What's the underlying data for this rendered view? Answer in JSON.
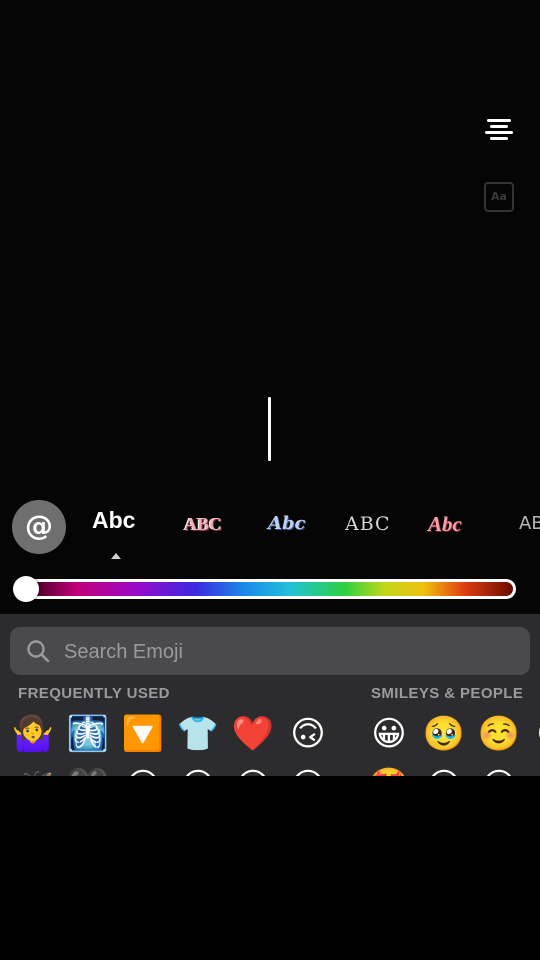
{
  "editor": {
    "align_icon": "align-center-icon",
    "font_size_label": "Aa"
  },
  "font_picker": {
    "mention_label": "@",
    "fonts": [
      "Abc",
      "ABC",
      "Abc",
      "ABC",
      "Abc",
      "AB"
    ],
    "selected_index": 0
  },
  "color_slider": {
    "value": 0.0
  },
  "emoji_keyboard": {
    "search": {
      "placeholder": "Search Emoji",
      "icon": "search-icon"
    },
    "sections": [
      "FREQUENTLY USED",
      "SMILEYS & PEOPLE"
    ],
    "row1": [
      "🤷‍♀️",
      "🩻",
      "🔽",
      "👕",
      "❤️",
      "🙃",
      "😀",
      "🥹",
      "☺️",
      "😀"
    ],
    "row2": [
      "🦋",
      "🖤",
      "😀",
      "😀",
      "😀",
      "😊",
      "🤩",
      "😅",
      "😀",
      "😀"
    ]
  }
}
